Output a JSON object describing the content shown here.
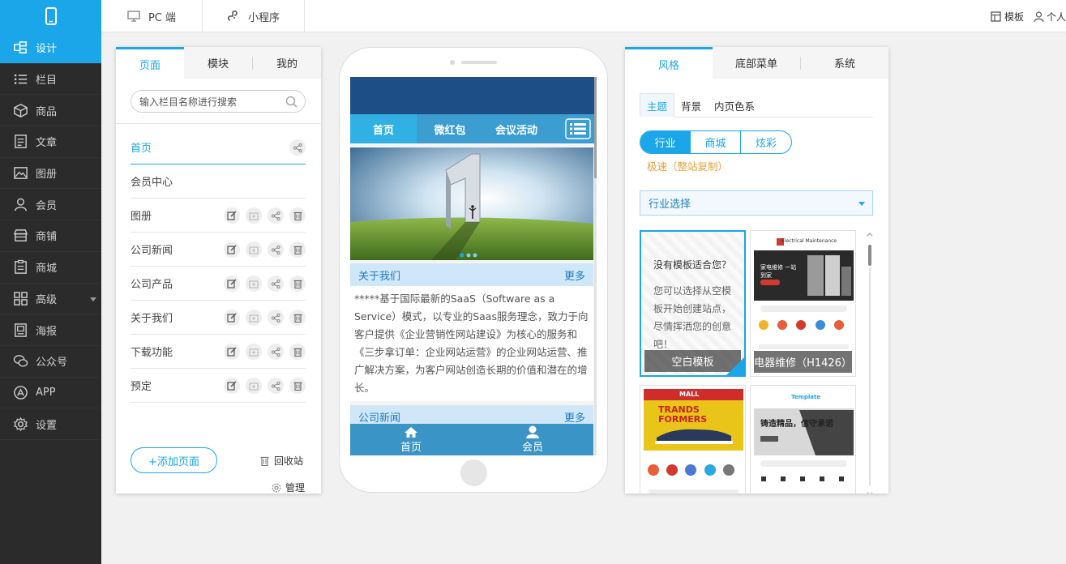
{
  "sidebar": {
    "items": [
      {
        "label": "设计",
        "icon": "design-icon",
        "active": true
      },
      {
        "label": "栏目",
        "icon": "list-icon"
      },
      {
        "label": "商品",
        "icon": "box-icon"
      },
      {
        "label": "文章",
        "icon": "article-icon"
      },
      {
        "label": "图册",
        "icon": "gallery-icon"
      },
      {
        "label": "会员",
        "icon": "member-icon"
      },
      {
        "label": "商铺",
        "icon": "store-icon"
      },
      {
        "label": "商城",
        "icon": "clipboard-icon"
      },
      {
        "label": "高级",
        "icon": "grid-icon"
      },
      {
        "label": "海报",
        "icon": "poster-icon"
      },
      {
        "label": "公众号",
        "icon": "wechat-icon"
      },
      {
        "label": "APP",
        "icon": "app-store-icon"
      },
      {
        "label": "设置",
        "icon": "gear-icon"
      }
    ]
  },
  "topbar": {
    "tabs": [
      {
        "label": "PC 端",
        "icon": "monitor-icon"
      },
      {
        "label": "小程序",
        "icon": "mini-program-icon"
      }
    ],
    "template_label": "模板",
    "personal_label": "个人"
  },
  "left_panel": {
    "tabs": [
      "页面",
      "模块",
      "我的"
    ],
    "search_placeholder": "输入栏目名称进行搜索",
    "pages": [
      {
        "label": "首页"
      },
      {
        "label": "会员中心"
      },
      {
        "label": "图册"
      },
      {
        "label": "公司新闻"
      },
      {
        "label": "公司产品"
      },
      {
        "label": "关于我们"
      },
      {
        "label": "下载功能"
      },
      {
        "label": "预定"
      }
    ],
    "add_page_label": "+添加页面",
    "recycle_label": "回收站",
    "manage_label": "管理"
  },
  "phone": {
    "nav": [
      "首页",
      "微红包",
      "会议活动"
    ],
    "about": {
      "title": "关于我们",
      "more": "更多"
    },
    "about_text": "*****基于国际最新的SaaS（Software as a Service）模式，以专业的Saas服务理念，致力于向客户提供《企业营销性网站建设》为核心的服务和《三步拿订单：企业网站运营》的企业网站运营、推广解决方案，为客户网站创造长期的价值和潜在的增长。",
    "news": {
      "title": "公司新闻",
      "more": "更多"
    },
    "tabbar": [
      "首页",
      "会员"
    ]
  },
  "right_panel": {
    "tabs": [
      "风格",
      "底部菜单",
      "系统"
    ],
    "subtabs": [
      "主题",
      "背景",
      "内页色系"
    ],
    "segments": [
      "行业",
      "商城",
      "炫彩"
    ],
    "fast_copy": "极速（整站复制）",
    "industry_select": "行业选择",
    "templates": [
      {
        "caption": "空白模板",
        "question": "没有模板适合您？",
        "desc": "您可以选择从空模板开始创建站点，尽情挥洒您的创意吧！"
      },
      {
        "caption": "电器维修（H1426）",
        "brand": "Electrical Maintenance",
        "promo": "家电维修 一站到家"
      },
      {
        "brand": "MALL",
        "promo": "TRANDS FORMERS"
      },
      {
        "brand": "Template",
        "promo": "铸造精品，信守承诺"
      }
    ]
  },
  "colors": {
    "accent": "#1aa6e8",
    "sidebar_bg": "#2b2b2b",
    "phone_header": "#1d4f86",
    "phone_nav": "#3b9dd0"
  }
}
